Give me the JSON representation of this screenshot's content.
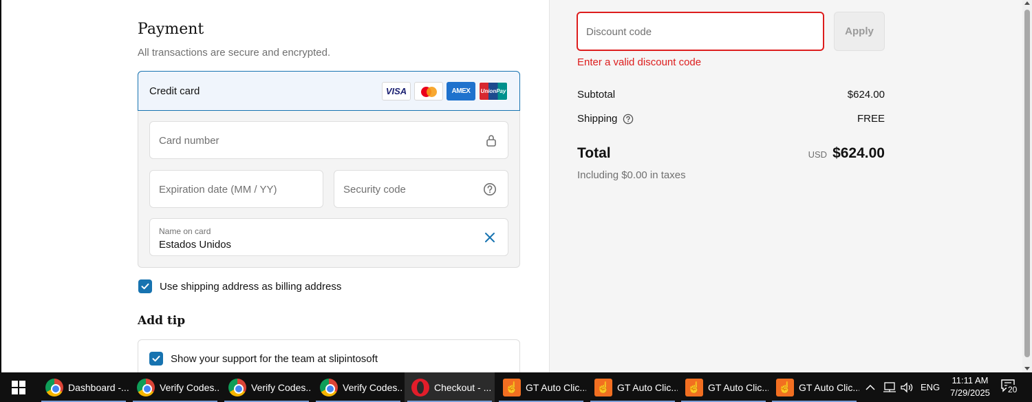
{
  "payment": {
    "title": "Payment",
    "subtitle": "All transactions are secure and encrypted.",
    "method_label": "Credit card",
    "brands": [
      "VISA",
      "Mastercard",
      "AMEX",
      "UnionPay"
    ],
    "amex_text": "AMEX",
    "unionpay_text": "UnionPay",
    "visa_text": "VISA",
    "card_number_placeholder": "Card number",
    "expiration_placeholder": "Expiration date (MM / YY)",
    "security_placeholder": "Security code",
    "name_label": "Name on card",
    "name_value": "Estados Unidos",
    "billing_checkbox_label": "Use shipping address as billing address",
    "billing_checked": true
  },
  "tip": {
    "title": "Add tip",
    "support_label": "Show your support for the team at slipintosoft",
    "support_checked": true
  },
  "summary": {
    "discount_placeholder": "Discount code",
    "apply_label": "Apply",
    "discount_error": "Enter a valid discount code",
    "subtotal_label": "Subtotal",
    "subtotal_value": "$624.00",
    "shipping_label": "Shipping",
    "shipping_value": "FREE",
    "total_label": "Total",
    "total_currency": "USD",
    "total_value": "$624.00",
    "taxes_note": "Including $0.00 in taxes"
  },
  "colors": {
    "accent": "#1773b0",
    "error": "#dd1d1d",
    "summary_bg": "#f5f5f5"
  },
  "taskbar": {
    "items": [
      {
        "label": "Dashboard -...",
        "icon": "chrome-icon"
      },
      {
        "label": "Verify Codes...",
        "icon": "chrome-icon"
      },
      {
        "label": "Verify Codes...",
        "icon": "chrome-icon"
      },
      {
        "label": "Verify Codes...",
        "icon": "chrome-icon"
      },
      {
        "label": "Checkout - ...",
        "icon": "opera-icon"
      },
      {
        "label": "GT Auto Clic...",
        "icon": "gt-auto-clicker-icon"
      },
      {
        "label": "GT Auto Clic...",
        "icon": "gt-auto-clicker-icon"
      },
      {
        "label": "GT Auto Clic...",
        "icon": "gt-auto-clicker-icon"
      },
      {
        "label": "GT Auto Clic...",
        "icon": "gt-auto-clicker-icon"
      }
    ],
    "language": "ENG",
    "time": "11:11 AM",
    "date": "7/29/2025",
    "notification_count": "20"
  }
}
